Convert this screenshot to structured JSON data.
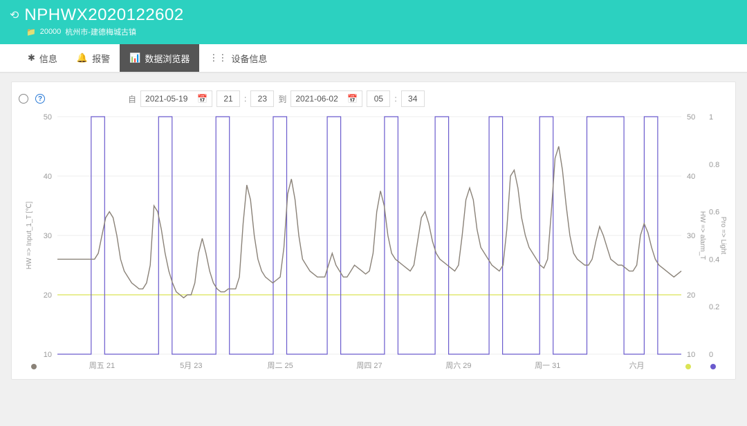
{
  "header": {
    "title": "NPHWX2020122602",
    "folder_icon": "📁",
    "code": "20000",
    "location": "杭州市-建德梅城古镇"
  },
  "tabs": [
    {
      "icon": "✱",
      "label": "信息"
    },
    {
      "icon": "🔔",
      "label": "报警"
    },
    {
      "icon": "📊",
      "label": "数据浏览器",
      "active": true
    },
    {
      "icon": "⋮⋮",
      "label": "设备信息"
    }
  ],
  "toolbar": {
    "from_label": "自",
    "from_date": "2021-05-19",
    "from_h": "21",
    "from_m": "23",
    "to_label": "到",
    "to_date": "2021-06-02",
    "to_h": "05",
    "to_m": "34",
    "colon": ":"
  },
  "chart_data": {
    "type": "line",
    "title": "",
    "x_categories": [
      "周五 21",
      "5月 23",
      "周二 25",
      "周四 27",
      "周六 29",
      "周一 31",
      "六月"
    ],
    "axes": {
      "left": {
        "label": "HW => Input_1_T [℃]",
        "min": 10,
        "max": 50,
        "ticks": [
          10,
          20,
          30,
          40,
          50
        ]
      },
      "right1": {
        "label": "HW => alarm_T",
        "min": 10,
        "max": 50,
        "ticks": [
          10,
          20,
          30,
          40,
          50
        ]
      },
      "right2": {
        "label": "Pro => Light",
        "min": 0,
        "max": 1,
        "ticks": [
          0,
          0.2,
          0.4,
          0.6,
          0.8,
          1
        ]
      }
    },
    "legend_dots": [
      {
        "label": "Input_1_T",
        "color": "#8a8278"
      },
      {
        "label": "alarm_T",
        "color": "#dbe455"
      },
      {
        "label": "Light",
        "color": "#6a5acd"
      }
    ],
    "series": [
      {
        "name": "Input_1_T",
        "axis": "left",
        "color": "#8a8278",
        "kind": "line",
        "values": [
          26,
          26,
          26,
          26,
          26,
          26,
          26,
          26,
          26,
          26,
          26,
          27,
          30,
          33,
          34,
          33,
          30,
          26,
          24,
          23,
          22,
          21.5,
          21,
          21,
          22,
          25,
          35,
          34,
          31,
          27,
          24,
          22,
          20.5,
          20,
          19.5,
          20,
          20,
          22,
          27,
          29.5,
          27,
          24,
          22,
          21,
          20.5,
          20.5,
          21,
          21,
          21,
          23,
          32,
          38.5,
          36,
          30,
          26,
          24,
          23,
          22.5,
          22,
          22.5,
          23,
          28,
          37,
          39.5,
          36,
          30,
          26,
          25,
          24,
          23.5,
          23,
          23,
          23,
          25,
          27,
          25,
          24,
          23,
          23,
          24,
          25,
          24.5,
          24,
          23.5,
          24,
          27,
          34,
          37.5,
          35,
          30,
          27,
          26,
          25.5,
          25,
          24.5,
          24,
          25,
          29,
          33,
          34,
          32,
          29,
          27,
          26,
          25.5,
          25,
          24.5,
          24,
          25,
          30,
          36,
          38,
          36,
          31,
          28,
          27,
          26,
          25,
          24.5,
          24,
          25,
          31,
          40,
          41,
          38,
          33,
          30,
          28,
          27,
          26,
          25,
          24.5,
          26,
          34,
          43,
          45,
          41,
          35,
          30,
          27,
          26,
          25.5,
          25,
          25,
          26,
          29,
          31.5,
          30,
          28,
          26,
          25.5,
          25,
          25,
          24.5,
          24,
          24,
          25,
          30,
          32,
          30.5,
          28,
          26,
          25,
          24.5,
          24,
          23.5,
          23,
          23.5,
          24
        ]
      },
      {
        "name": "alarm_T",
        "axis": "right1",
        "color": "#dbe455",
        "kind": "line",
        "values_constant": 20
      },
      {
        "name": "Light",
        "axis": "right2",
        "color": "#6a5acd",
        "kind": "step01",
        "blocks": [
          [
            10,
            14
          ],
          [
            30,
            34
          ],
          [
            47,
            51
          ],
          [
            64,
            68
          ],
          [
            80,
            84
          ],
          [
            97,
            101
          ],
          [
            112,
            116
          ],
          [
            128,
            132
          ],
          [
            143,
            147
          ],
          [
            157,
            168
          ],
          [
            174,
            178
          ]
        ],
        "n": 186
      }
    ]
  }
}
